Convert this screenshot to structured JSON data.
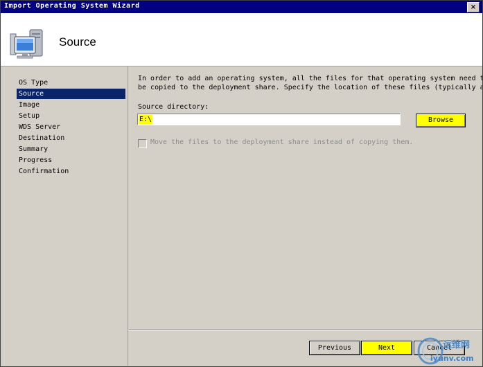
{
  "window": {
    "title": "Import Operating System Wizard",
    "close_glyph": "×"
  },
  "header": {
    "title": "Source",
    "icon": "computer-monitor-icon"
  },
  "nav": {
    "items": [
      {
        "label": "OS Type",
        "selected": false
      },
      {
        "label": "Source",
        "selected": true
      },
      {
        "label": "Image",
        "selected": false
      },
      {
        "label": "Setup",
        "selected": false
      },
      {
        "label": "WDS Server",
        "selected": false
      },
      {
        "label": "Destination",
        "selected": false
      },
      {
        "label": "Summary",
        "selected": false
      },
      {
        "label": "Progress",
        "selected": false
      },
      {
        "label": "Confirmation",
        "selected": false
      }
    ]
  },
  "main": {
    "description_line1": "In order to add an operating system, all the files for that operating system need to",
    "description_line2": "be copied to the deployment share.  Specify the location of these files (typically a",
    "source_label": "Source directory:",
    "source_value": "E:\\",
    "browse_label": "Browse",
    "move_checkbox_label": "Move the files to the deployment share instead of copying them.",
    "move_checkbox_checked": false
  },
  "footer": {
    "previous_label": "Previous",
    "next_label": "Next",
    "cancel_label": "Cancel"
  },
  "watermark": {
    "line1": "运维网",
    "line2": "iyunv.com"
  },
  "colors": {
    "titlebar": "#000080",
    "selection": "#0a246a",
    "highlight": "#ffff00",
    "face": "#d4d0c8"
  }
}
